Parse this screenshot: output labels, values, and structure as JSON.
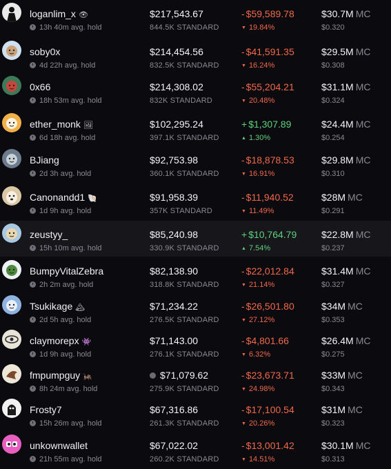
{
  "rows": [
    {
      "name": "loganlim_x",
      "emoji": "👁",
      "hold": "13h 40m avg. hold",
      "value": "$217,543.67",
      "standard": "844.5K STANDARD",
      "pnl_sign": "-",
      "pnl": "$59,589.78",
      "pnl_dir": "neg",
      "pct": "19.84%",
      "mc": "$30.7M",
      "mc_label": "MC",
      "price": "$0.320",
      "coin": false,
      "highlight": false
    },
    {
      "name": "soby0x",
      "emoji": "",
      "hold": "4d 22h avg. hold",
      "value": "$214,454.56",
      "standard": "832.5K STANDARD",
      "pnl_sign": "-",
      "pnl": "$41,591.35",
      "pnl_dir": "neg",
      "pct": "16.24%",
      "mc": "$29.5M",
      "mc_label": "MC",
      "price": "$0.308",
      "coin": false,
      "highlight": false
    },
    {
      "name": "0x66",
      "emoji": "",
      "hold": "18h 53m avg. hold",
      "value": "$214,308.02",
      "standard": "832K STANDARD",
      "pnl_sign": "-",
      "pnl": "$55,204.21",
      "pnl_dir": "neg",
      "pct": "20.48%",
      "mc": "$31.1M",
      "mc_label": "MC",
      "price": "$0.324",
      "coin": false,
      "highlight": false
    },
    {
      "name": "ether_monk",
      "emoji": "🖼",
      "hold": "6d 18h avg. hold",
      "value": "$102,295.24",
      "standard": "397.1K STANDARD",
      "pnl_sign": "+",
      "pnl": "$1,307.89",
      "pnl_dir": "pos",
      "pct": "1.30%",
      "mc": "$24.4M",
      "mc_label": "MC",
      "price": "$0.254",
      "coin": false,
      "highlight": false
    },
    {
      "name": "BJiang",
      "emoji": "",
      "hold": "2d 3h avg. hold",
      "value": "$92,753.98",
      "standard": "360.1K STANDARD",
      "pnl_sign": "-",
      "pnl": "$18,878.53",
      "pnl_dir": "neg",
      "pct": "16.91%",
      "mc": "$29.8M",
      "mc_label": "MC",
      "price": "$0.310",
      "coin": false,
      "highlight": false
    },
    {
      "name": "Canonandd1",
      "emoji": "🐚",
      "hold": "1d 9h avg. hold",
      "value": "$91,958.39",
      "standard": "357K STANDARD",
      "pnl_sign": "-",
      "pnl": "$11,940.52",
      "pnl_dir": "neg",
      "pct": "11.49%",
      "mc": "$28M",
      "mc_label": "MC",
      "price": "$0.291",
      "coin": false,
      "highlight": false
    },
    {
      "name": "zeustyy_",
      "emoji": "",
      "hold": "15h 10m avg. hold",
      "value": "$85,240.98",
      "standard": "330.9K STANDARD",
      "pnl_sign": "+",
      "pnl": "$10,764.79",
      "pnl_dir": "pos",
      "pct": "7.54%",
      "mc": "$22.8M",
      "mc_label": "MC",
      "price": "$0.237",
      "coin": false,
      "highlight": true
    },
    {
      "name": "BumpyVitalZebra",
      "emoji": "",
      "hold": "2h 2m avg. hold",
      "value": "$82,138.90",
      "standard": "318.8K STANDARD",
      "pnl_sign": "-",
      "pnl": "$22,012.84",
      "pnl_dir": "neg",
      "pct": "21.14%",
      "mc": "$31.4M",
      "mc_label": "MC",
      "price": "$0.327",
      "coin": false,
      "highlight": false
    },
    {
      "name": "Tsukikage",
      "emoji": "🏔",
      "hold": "2d 5h avg. hold",
      "value": "$71,234.22",
      "standard": "276.5K STANDARD",
      "pnl_sign": "-",
      "pnl": "$26,501.80",
      "pnl_dir": "neg",
      "pct": "27.12%",
      "mc": "$34M",
      "mc_label": "MC",
      "price": "$0.353",
      "coin": false,
      "highlight": false
    },
    {
      "name": "claymorepx",
      "emoji": "👾",
      "hold": "1d 9h avg. hold",
      "value": "$71,143.00",
      "standard": "276.1K STANDARD",
      "pnl_sign": "-",
      "pnl": "$4,801.66",
      "pnl_dir": "neg",
      "pct": "6.32%",
      "mc": "$26.4M",
      "mc_label": "MC",
      "price": "$0.275",
      "coin": false,
      "highlight": false
    },
    {
      "name": "fmpumpguy",
      "emoji": "🦗",
      "hold": "8h 24m avg. hold",
      "value": "$71,079.62",
      "standard": "275.9K STANDARD",
      "pnl_sign": "-",
      "pnl": "$23,673.71",
      "pnl_dir": "neg",
      "pct": "24.98%",
      "mc": "$33M",
      "mc_label": "MC",
      "price": "$0.343",
      "coin": true,
      "highlight": false
    },
    {
      "name": "Frosty7",
      "emoji": "",
      "hold": "15h 26m avg. hold",
      "value": "$67,316.86",
      "standard": "261.3K STANDARD",
      "pnl_sign": "-",
      "pnl": "$17,100.54",
      "pnl_dir": "neg",
      "pct": "20.26%",
      "mc": "$31M",
      "mc_label": "MC",
      "price": "$0.323",
      "coin": false,
      "highlight": false
    },
    {
      "name": "unkownwallet",
      "emoji": "",
      "hold": "21h 55m avg. hold",
      "value": "$67,022.02",
      "standard": "260.2K STANDARD",
      "pnl_sign": "-",
      "pnl": "$13,001.42",
      "pnl_dir": "neg",
      "pct": "14.51%",
      "mc": "$30.1M",
      "mc_label": "MC",
      "price": "$0.313",
      "coin": false,
      "highlight": false
    }
  ],
  "colors": {
    "negative": "#f0684a",
    "positive": "#5fd17e",
    "background": "#0b0b0f",
    "highlight_row": "#16161b"
  },
  "avatars": [
    "dark-figure",
    "cartoon-face",
    "red-mask",
    "orange-character",
    "grey-portrait",
    "white-dog",
    "blue-character",
    "green-frog",
    "blue-cat",
    "sketch-eye",
    "brown-bird",
    "white-ghost",
    "pink-mascot"
  ]
}
